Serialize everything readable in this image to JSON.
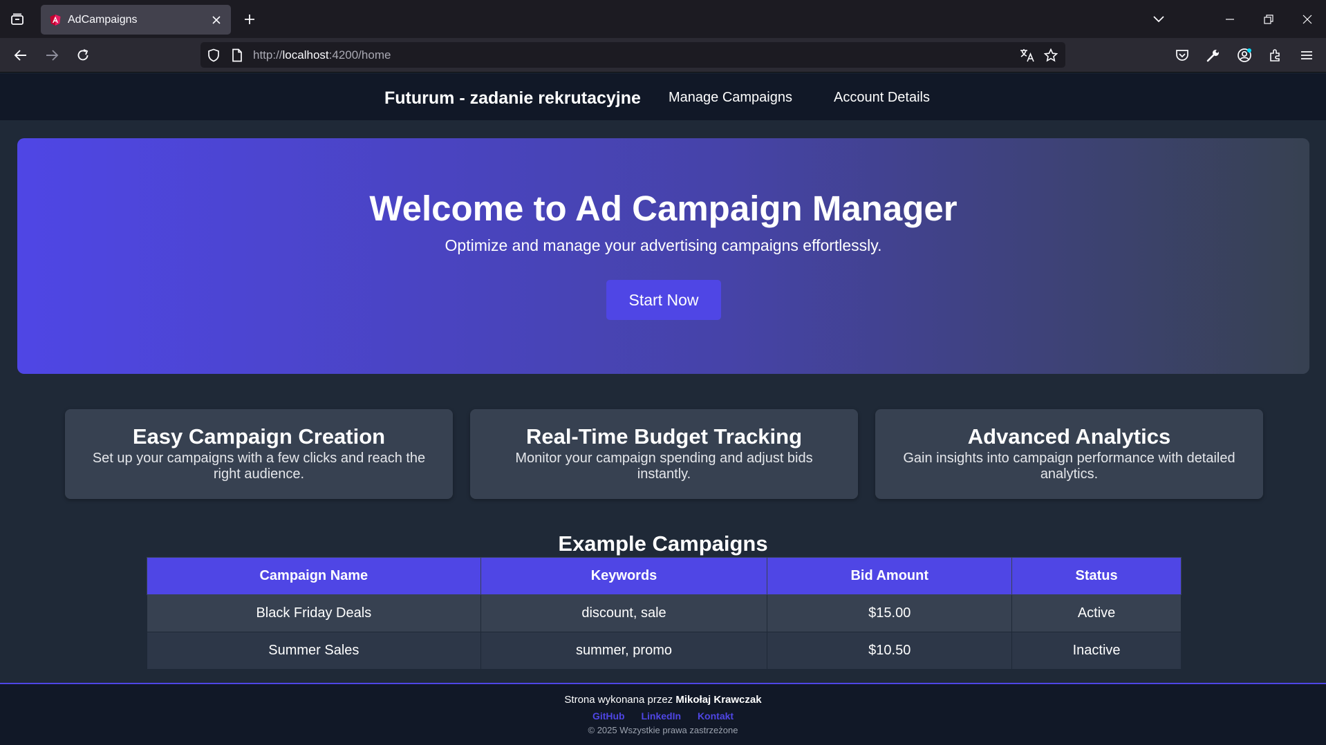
{
  "browser": {
    "tab_title": "AdCampaigns",
    "url_scheme": "http://",
    "url_host": "localhost",
    "url_rest": ":4200/home"
  },
  "header": {
    "brand": "Futurum - zadanie rekrutacyjne",
    "nav": [
      "Manage Campaigns",
      "Account Details"
    ]
  },
  "hero": {
    "title": "Welcome to Ad Campaign Manager",
    "subtitle": "Optimize and manage your advertising campaigns effortlessly.",
    "cta": "Start Now"
  },
  "features": [
    {
      "title": "Easy Campaign Creation",
      "text": "Set up your campaigns with a few clicks and reach the right audience."
    },
    {
      "title": "Real-Time Budget Tracking",
      "text": "Monitor your campaign spending and adjust bids instantly."
    },
    {
      "title": "Advanced Analytics",
      "text": "Gain insights into campaign performance with detailed analytics."
    }
  ],
  "campaigns": {
    "title": "Example Campaigns",
    "columns": [
      "Campaign Name",
      "Keywords",
      "Bid Amount",
      "Status"
    ],
    "rows": [
      [
        "Black Friday Deals",
        "discount, sale",
        "$15.00",
        "Active"
      ],
      [
        "Summer Sales",
        "summer, promo",
        "$10.50",
        "Inactive"
      ]
    ]
  },
  "footer": {
    "credit_prefix": "Strona wykonana przez",
    "author": "Mikołaj Krawczak",
    "links": [
      "GitHub",
      "LinkedIn",
      "Kontakt"
    ],
    "copyright": "© 2025 Wszystkie prawa zastrzeżone"
  },
  "colors": {
    "accent": "#4f46e5",
    "page_bg": "#1f2937",
    "header_bg": "#111827",
    "card_bg": "#374151"
  },
  "icons": [
    "tab-list-icon",
    "angular-favicon-icon",
    "close-icon",
    "plus-icon",
    "chevron-down-icon",
    "minimize-icon",
    "restore-icon",
    "back-arrow-icon",
    "forward-arrow-icon",
    "reload-icon",
    "shield-icon",
    "page-icon",
    "translate-icon",
    "star-icon",
    "pocket-icon",
    "wrench-icon",
    "account-icon",
    "extensions-icon",
    "menu-icon"
  ]
}
